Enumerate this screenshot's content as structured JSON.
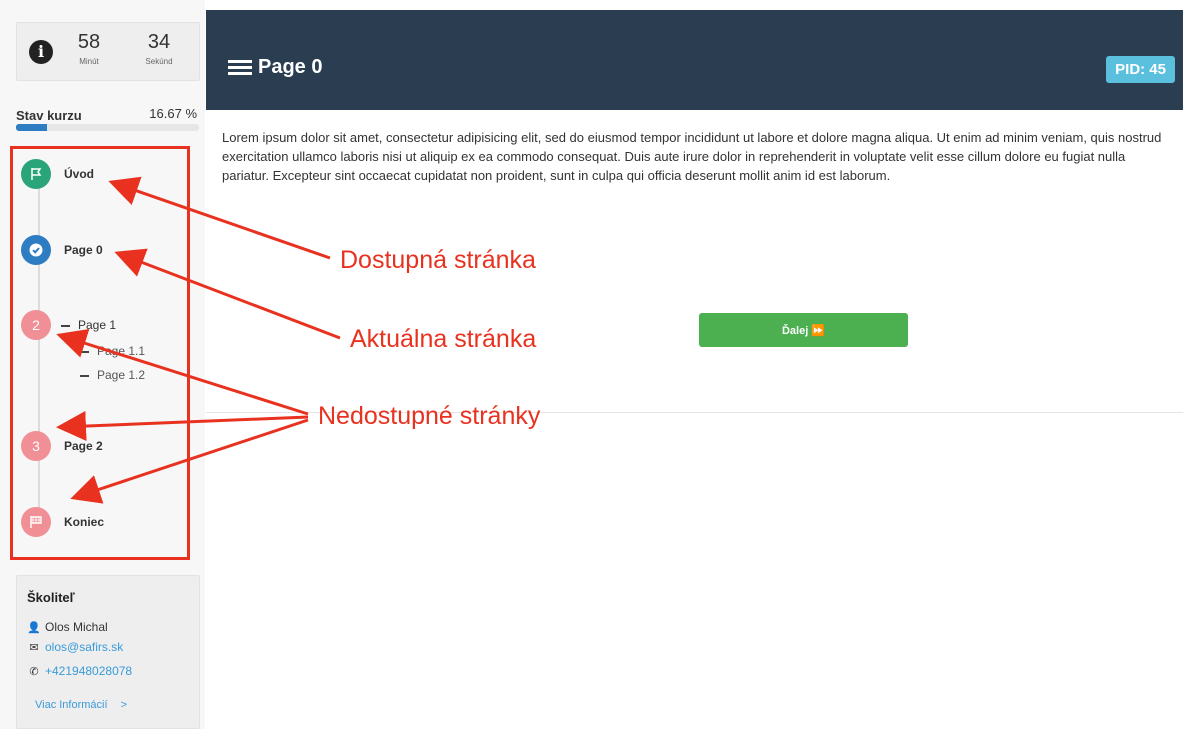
{
  "timer": {
    "minutes": "58",
    "minutes_label": "Minút",
    "seconds": "34",
    "seconds_label": "Sekúnd"
  },
  "progress": {
    "label": "Stav kurzu",
    "value_text": "16.67 %",
    "fraction": 0.1667
  },
  "nav": {
    "items": [
      {
        "label": "Úvod",
        "badge": "",
        "state": "available",
        "color": "#2aa57a",
        "icon": "flag-icon"
      },
      {
        "label": "Page 0",
        "badge": "",
        "state": "current",
        "color": "#2e7cc1",
        "icon": "check-circle-icon"
      },
      {
        "label": "Page 1",
        "badge": "2",
        "state": "unavailable",
        "color": "#f08f95"
      },
      {
        "label": "Page 2",
        "badge": "3",
        "state": "unavailable",
        "color": "#f08f95"
      },
      {
        "label": "Koniec",
        "badge": "",
        "state": "unavailable",
        "color": "#f08f95",
        "icon": "finish-flag-icon"
      }
    ],
    "subitems": [
      "Page 1.1",
      "Page 1.2"
    ]
  },
  "trainer": {
    "title": "Školiteľ",
    "name": "Olos Michal",
    "email": "olos@safirs.sk",
    "phone": "+421948028078",
    "more": "Viac Informácií",
    "more_arrow": ">"
  },
  "header": {
    "title": "Page 0",
    "pid": "PID: 45",
    "bg_color": "#2b3d50",
    "badge_color": "#5bc0de"
  },
  "content": {
    "text": "Lorem ipsum dolor sit amet, consectetur adipisicing elit, sed do eiusmod tempor incididunt ut labore et dolore magna aliqua. Ut enim ad minim veniam, quis nostrud exercitation ullamco laboris nisi ut aliquip ex ea commodo consequat. Duis aute irure dolor in reprehenderit in voluptate velit esse cillum dolore eu fugiat nulla pariatur. Excepteur sint occaecat cupidatat non proident, sunt in culpa qui officia deserunt mollit anim id est laborum.",
    "next_button": "Ďalej ⏩"
  },
  "annotations": {
    "available": "Dostupná stránka",
    "current": "Aktuálna stránka",
    "unavailable": "Nedostupné stránky",
    "color": "#e8321f"
  }
}
